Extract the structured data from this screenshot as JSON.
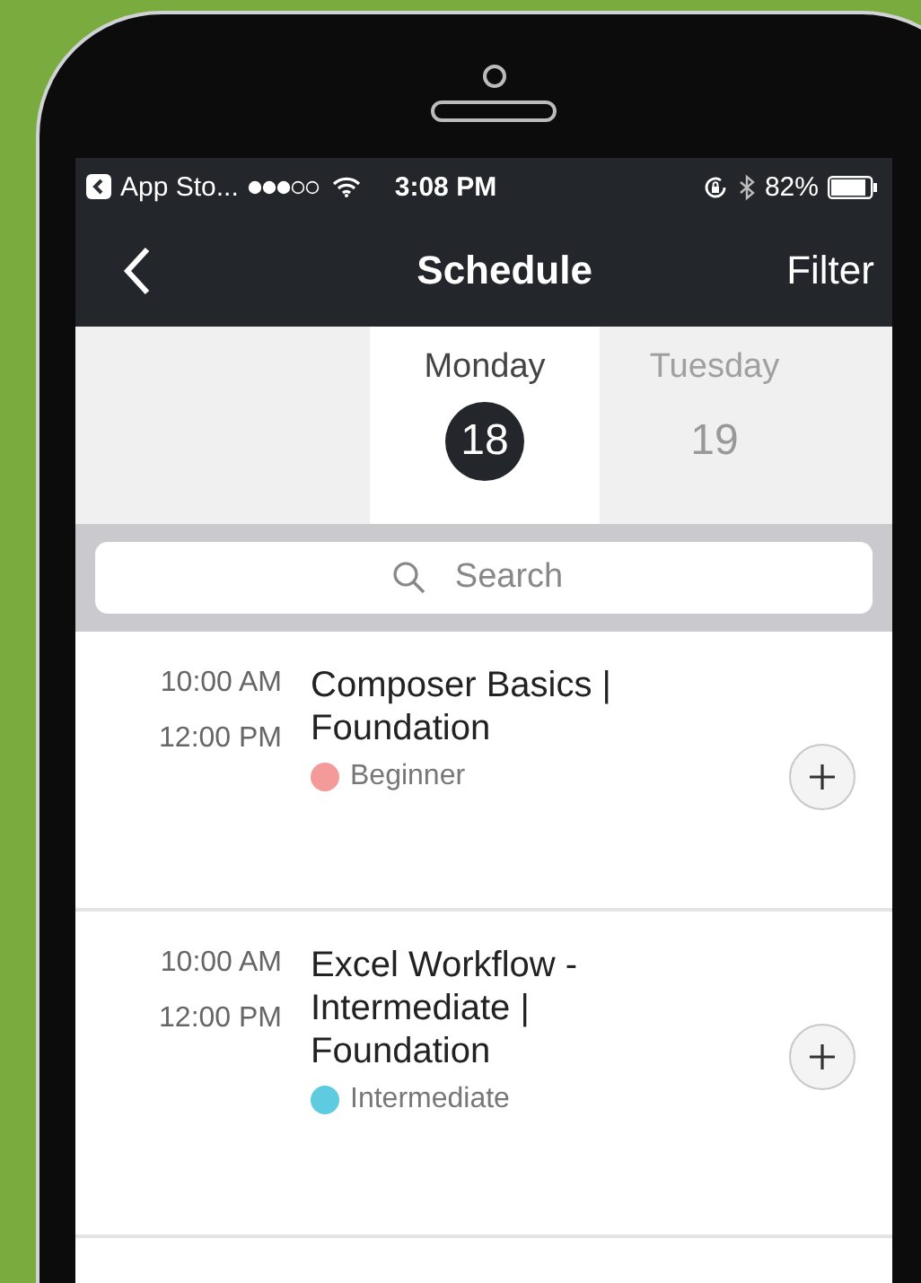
{
  "status_bar": {
    "back_app": "App Sto...",
    "time": "3:08 PM",
    "battery": "82%"
  },
  "nav": {
    "title": "Schedule",
    "action": "Filter"
  },
  "days": [
    {
      "name": "Monday",
      "date": "18",
      "selected": true
    },
    {
      "name": "Tuesday",
      "date": "19",
      "selected": false
    }
  ],
  "search": {
    "placeholder": "Search"
  },
  "sessions": [
    {
      "start": "10:00 AM",
      "end": "12:00 PM",
      "title": "Composer Basics | Foundation",
      "level": "Beginner",
      "color": "#f49a9a"
    },
    {
      "start": "10:00 AM",
      "end": "12:00 PM",
      "title": "Excel Workflow - Intermediate | Foundation",
      "level": "Intermediate",
      "color": "#5fcbe0"
    }
  ]
}
